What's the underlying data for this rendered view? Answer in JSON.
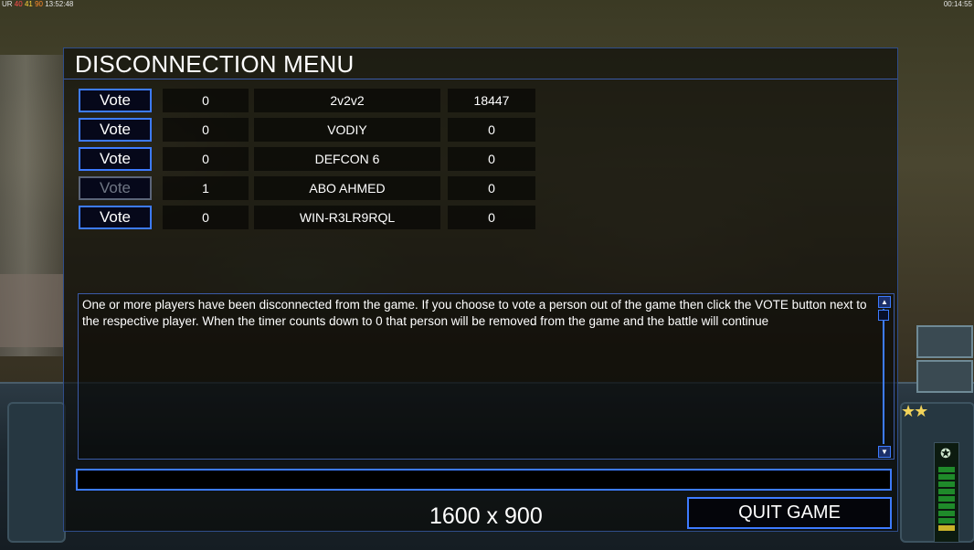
{
  "hud": {
    "stats": [
      "UR",
      "40",
      "41",
      "90",
      "13:52:48"
    ],
    "timer": "00:14:55"
  },
  "dialog": {
    "title": "DISCONNECTION MENU",
    "players": [
      {
        "vote_label": "Vote",
        "votes": "0",
        "name": "2v2v2",
        "ping": "18447",
        "vote_enabled": true
      },
      {
        "vote_label": "Vote",
        "votes": "0",
        "name": "VODIY",
        "ping": "0",
        "vote_enabled": true
      },
      {
        "vote_label": "Vote",
        "votes": "0",
        "name": "DEFCON 6",
        "ping": "0",
        "vote_enabled": true
      },
      {
        "vote_label": "Vote",
        "votes": "1",
        "name": "ABO AHMED",
        "ping": "0",
        "vote_enabled": false
      },
      {
        "vote_label": "Vote",
        "votes": "0",
        "name": "WIN-R3LR9RQL",
        "ping": "0",
        "vote_enabled": true
      }
    ],
    "message": "One or more players have been disconnected from the game. If you choose to vote a person out of the game then click the VOTE button next to the respective player. When the timer counts down to 0 that person will be removed from the game and the battle will continue",
    "chat_input": {
      "value": "",
      "placeholder": ""
    },
    "resolution": "1600 x 900",
    "quit_label": "QUIT GAME"
  },
  "colors": {
    "accent": "#3d7bff",
    "disabled": "#5b6579",
    "star": "#f2d35a",
    "power": "#1f8a2a"
  },
  "icons": [
    "scroll-up-icon",
    "scroll-down-icon",
    "rank-star-icon",
    "faction-emblem-icon"
  ]
}
